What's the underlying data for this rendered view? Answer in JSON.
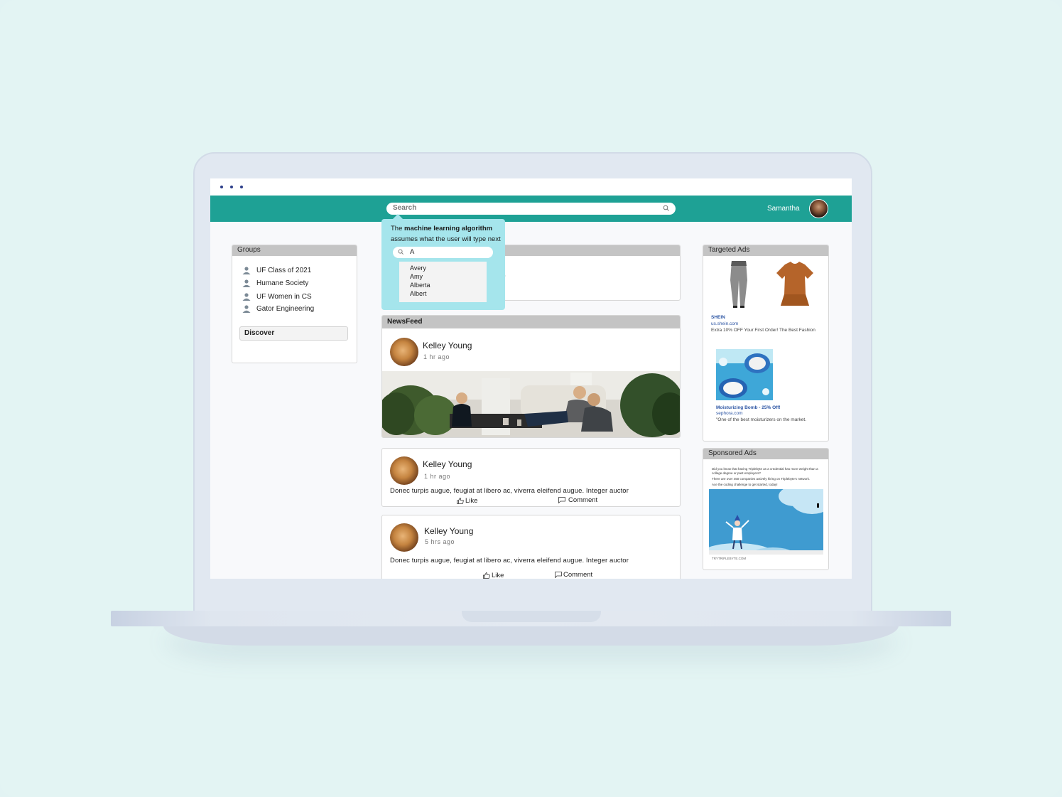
{
  "topbar": {
    "search_placeholder": "Search",
    "username": "Samantha"
  },
  "tooltip": {
    "line1_prefix": "The ",
    "line1_bold": "machine learning algorithm",
    "line2": "assumes what the user will type next",
    "input_value": "A",
    "suggestions": [
      "Avery",
      "Amy",
      "Alberta",
      "Albert"
    ]
  },
  "groups": {
    "title": "Groups",
    "items": [
      "UF Class of 2021",
      "Humane Society",
      "UF Women in CS",
      "Gator Engineering"
    ],
    "discover_label": "Discover"
  },
  "hidden_panel": {
    "partial_text": "?"
  },
  "newsfeed": {
    "title": "NewsFeed",
    "posts": [
      {
        "author": "Kelley Young",
        "time": "1 hr ago"
      },
      {
        "author": "Kelley Young",
        "time": "1 hr ago",
        "text": "Donec turpis augue, feugiat at libero ac, viverra eleifend augue. Integer auctor",
        "like": "Like",
        "comment": "Comment"
      },
      {
        "author": "Kelley Young",
        "time": "5 hrs ago",
        "text": "Donec turpis augue, feugiat at libero ac, viverra eleifend augue. Integer auctor",
        "like": "Like",
        "comment": "Comment"
      }
    ]
  },
  "targeted_ads": {
    "title": "Targeted Ads",
    "ad1": {
      "brand": "SHEIN",
      "url": "us.shein.com",
      "desc": "Extra 10% OFF Your First Order! The Best Fashion"
    },
    "ad2": {
      "brand": "Moisturizing Bomb - 25% Off!",
      "url": "sephora.com",
      "desc": "\"One of the best moisturizers on the market."
    }
  },
  "sponsored_ads": {
    "title": "Sponsored Ads",
    "lines": [
      "Did you know that having Triplebyte as a credential has more weight than a",
      "college degree or past employers?",
      "There are over 450 companies actively hiring on Triplebyte's network.",
      "Ace the coding challenge to get started, today!"
    ],
    "footer": "TRYTRIPLEBYTE.COM"
  },
  "colors": {
    "accent": "#1ea195",
    "tooltip": "#a5e5ec",
    "link": "#2b54a3"
  }
}
